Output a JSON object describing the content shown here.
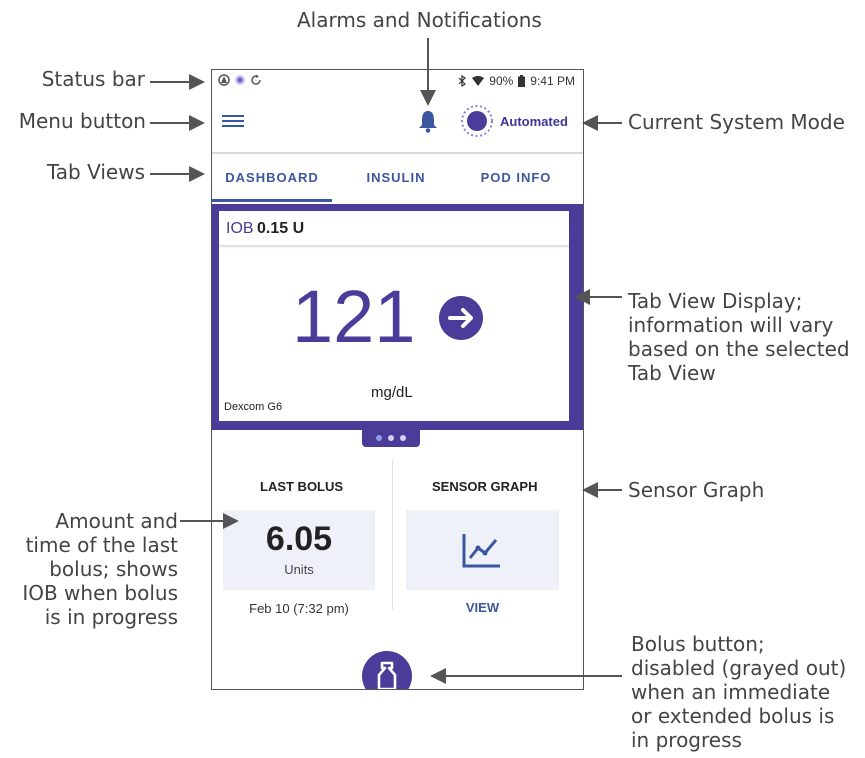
{
  "callouts": {
    "alarms": "Alarms and Notifications",
    "status_bar": "Status bar",
    "menu_button": "Menu button",
    "tab_views": "Tab Views",
    "current_mode": "Current System Mode",
    "tab_display": [
      "Tab View Display;",
      "information will vary",
      "based on the selected",
      "Tab View"
    ],
    "sensor_graph": "Sensor Graph",
    "last_bolus": [
      "Amount and",
      "time of the last",
      "bolus; shows",
      "IOB when bolus",
      "is in progress"
    ],
    "bolus_button": [
      "Bolus button;",
      "disabled (grayed out)",
      "when an immediate",
      "or extended bolus is",
      "in progress"
    ]
  },
  "status_bar": {
    "battery": "90%",
    "time": "9:41 PM"
  },
  "app_bar": {
    "mode_label": "Automated"
  },
  "tabs": [
    {
      "label": "DASHBOARD",
      "active": true
    },
    {
      "label": "INSULIN",
      "active": false
    },
    {
      "label": "POD INFO",
      "active": false
    }
  ],
  "dashboard": {
    "iob_label": "IOB",
    "iob_value": "0.15 U",
    "glucose": "121",
    "trend": "arrow-right-icon",
    "units": "mg/dL",
    "sensor": "Dexcom G6",
    "page_dots": 3,
    "active_dot": 1
  },
  "last_bolus": {
    "title": "LAST BOLUS",
    "amount": "6.05",
    "unit": "Units",
    "time": "Feb 10 (7:32 pm)"
  },
  "sensor_graph": {
    "title": "SENSOR GRAPH",
    "view_label": "VIEW"
  },
  "colors": {
    "primary": "#4b3c99",
    "accent": "#3c57a0",
    "card": "#eef2f8"
  }
}
